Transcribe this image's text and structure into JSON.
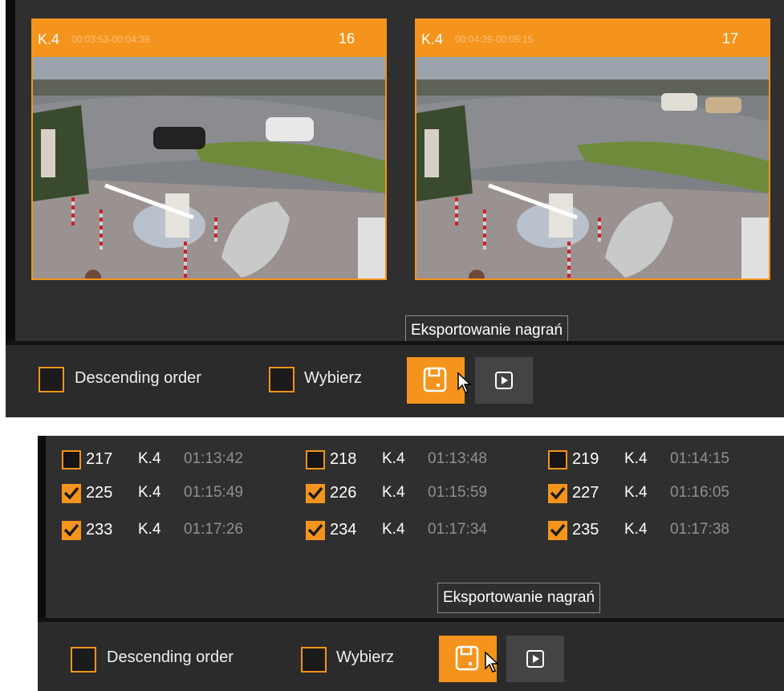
{
  "top_panel": {
    "thumbnails": [
      {
        "camera": "K.4",
        "time_range": "00:03:53-00:04:39",
        "number": "16",
        "checked": true
      },
      {
        "camera": "K.4",
        "time_range": "00:04:39-00:05:15",
        "number": "17",
        "checked": true
      }
    ],
    "tooltip": "Eksportowanie nagrań",
    "toolbar": {
      "descending_label": "Descending order",
      "select_label": "Wybierz"
    }
  },
  "bottom_panel": {
    "rows": [
      [
        {
          "id": "217",
          "camera": "K.4",
          "time": "01:13:42",
          "checked": false
        },
        {
          "id": "218",
          "camera": "K.4",
          "time": "01:13:48",
          "checked": false
        },
        {
          "id": "219",
          "camera": "K.4",
          "time": "01:14:15",
          "checked": false
        }
      ],
      [
        {
          "id": "225",
          "camera": "K.4",
          "time": "01:15:49",
          "checked": true
        },
        {
          "id": "226",
          "camera": "K.4",
          "time": "01:15:59",
          "checked": true
        },
        {
          "id": "227",
          "camera": "K.4",
          "time": "01:16:05",
          "checked": true
        }
      ],
      [
        {
          "id": "233",
          "camera": "K.4",
          "time": "01:17:26",
          "checked": true
        },
        {
          "id": "234",
          "camera": "K.4",
          "time": "01:17:34",
          "checked": true
        },
        {
          "id": "235",
          "camera": "K.4",
          "time": "01:17:38",
          "checked": true
        }
      ]
    ],
    "tooltip": "Eksportowanie nagrań",
    "toolbar": {
      "descending_label": "Descending order",
      "select_label": "Wybierz"
    }
  },
  "icons": {
    "export": "floppy-export-icon",
    "play": "play-icon",
    "cursor": "mouse-cursor-icon",
    "check": "checkmark-icon"
  },
  "colors": {
    "accent": "#f4941c",
    "panel_bg": "#2f2f2f",
    "dim_text": "#8f8f8f"
  }
}
